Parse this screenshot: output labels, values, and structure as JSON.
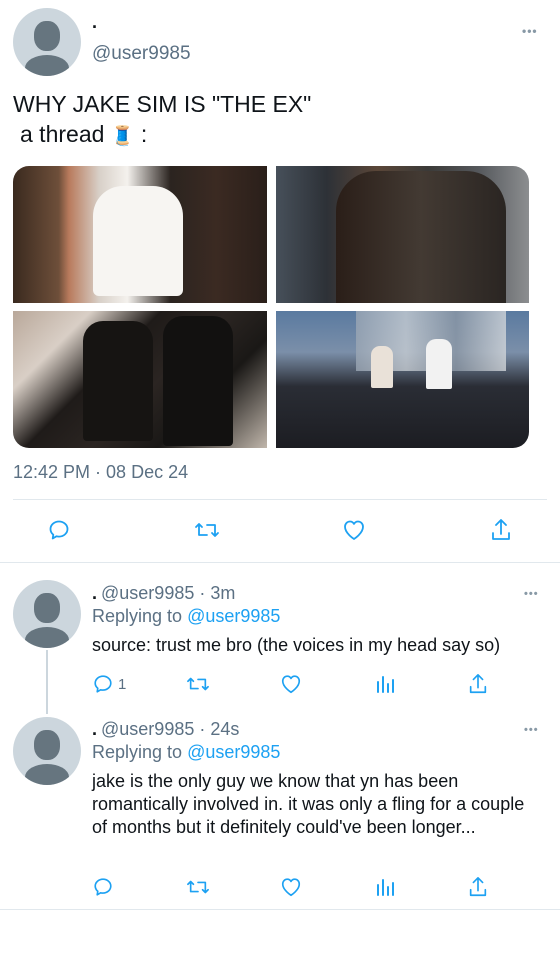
{
  "main_tweet": {
    "display_name": ".",
    "handle": "@user9985",
    "text_line1": "WHY JAKE SIM IS \"THE EX\"",
    "text_line2": "a thread",
    "thread_emoji": "🧵",
    "text_line2_suffix": ":",
    "timestamp": "12:42 PM · 08 Dec 24",
    "more_label": "•••"
  },
  "replies": [
    {
      "display_name": ".",
      "handle_time": "@user9985 · 3m",
      "replying_prefix": "Replying to",
      "replying_to": "@user9985",
      "text": "source: trust me bro (the voices in my head say so)",
      "reply_count": "1",
      "more_label": "•••"
    },
    {
      "display_name": ".",
      "handle_time": "@user9985 · 24s",
      "replying_prefix": "Replying to",
      "replying_to": "@user9985",
      "text": "jake is the only guy we know that yn has been romantically involved in. it was only a fling for a couple of months but it definitely could've been longer...",
      "reply_count": "",
      "more_label": "•••"
    }
  ],
  "colors": {
    "accent": "#1da1f2",
    "secondary_text": "#5b7083",
    "divider": "#e1e8ed"
  },
  "icons": {
    "reply": "reply-icon",
    "retweet": "retweet-icon",
    "like": "heart-icon",
    "analytics": "analytics-icon",
    "share": "share-icon",
    "more": "more-icon",
    "avatar": "default-avatar-icon"
  }
}
